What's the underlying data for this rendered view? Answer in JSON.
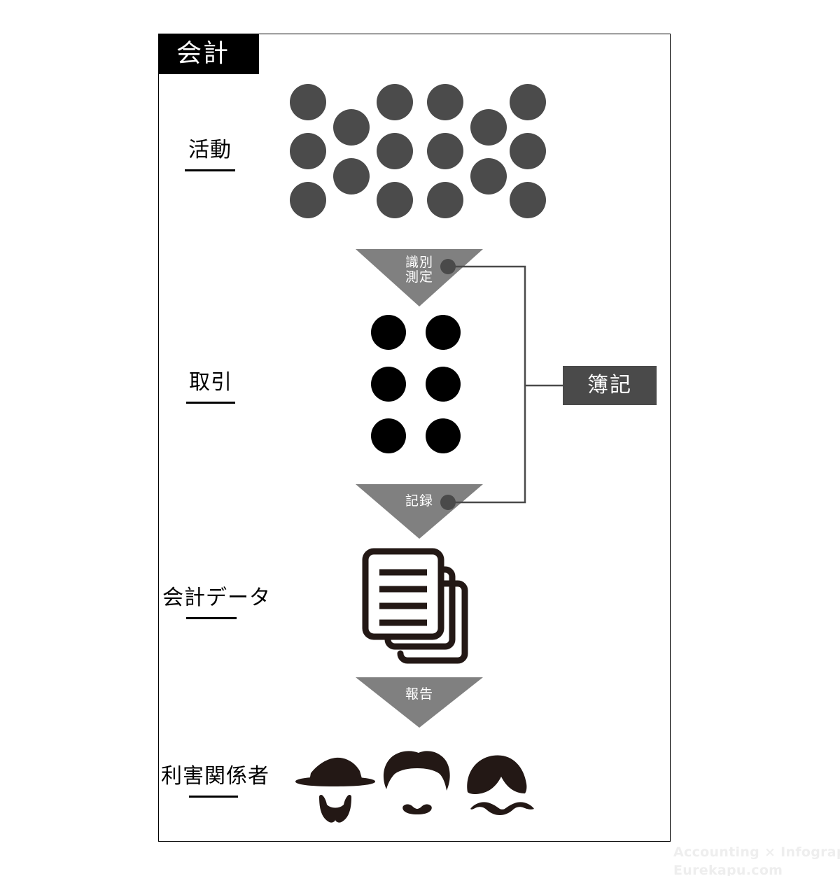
{
  "colors": {
    "panel_border": "#000000",
    "title_badge_bg": "#000000",
    "title_badge_text": "#ffffff",
    "activity_circle": "#4b4b4b",
    "transaction_circle": "#000000",
    "arrow_fill": "#808080",
    "arrow_text": "#ffffff",
    "connector_line": "#4a4a4a",
    "connector_dot": "#4a4a4a",
    "bookkeeping_bg": "#4a4a4a",
    "bookkeeping_text": "#ffffff",
    "document_icon": "#231815",
    "stakeholder_icon": "#231815",
    "watermark_text": "#eeeeee",
    "background": "#ffffff"
  },
  "title": {
    "label": "会計"
  },
  "rows": [
    {
      "key": "activity",
      "label": "活動",
      "icon": "gray-circle-cluster"
    },
    {
      "key": "transaction",
      "label": "取引",
      "icon": "black-circle-grid"
    },
    {
      "key": "accounting_data",
      "label": "会計データ",
      "icon": "document-stack-icon"
    },
    {
      "key": "stakeholders",
      "label": "利害関係者",
      "icon": "stakeholder-faces-icon"
    }
  ],
  "arrows": [
    {
      "key": "identify",
      "line1": "識別",
      "line2": "測定",
      "has_connector_dot": true
    },
    {
      "key": "record",
      "line1": "記録",
      "line2": "",
      "has_connector_dot": true
    },
    {
      "key": "report",
      "line1": "報告",
      "line2": "",
      "has_connector_dot": false
    }
  ],
  "bookkeeping": {
    "label": "簿記"
  },
  "counts": {
    "activity_circles": 16,
    "transaction_circles": 6,
    "document_pages": 3,
    "stakeholder_figures": 3
  },
  "watermark": {
    "line1": "Accounting × Infographic",
    "line2": "Eurekapu.com"
  }
}
